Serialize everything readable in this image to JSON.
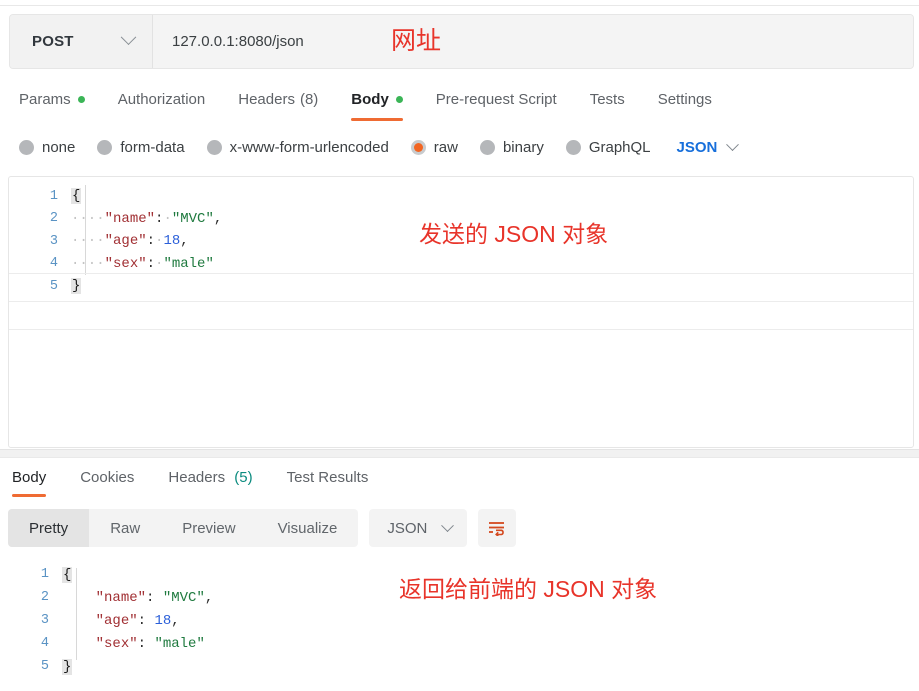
{
  "request": {
    "method": "POST",
    "url": "127.0.0.1:8080/json",
    "tabs": [
      {
        "label": "Params",
        "dot": true,
        "active": false
      },
      {
        "label": "Authorization",
        "dot": false,
        "active": false
      },
      {
        "label": "Headers",
        "count": "(8)",
        "dot": false,
        "active": false
      },
      {
        "label": "Body",
        "dot": true,
        "active": true
      },
      {
        "label": "Pre-request Script",
        "dot": false,
        "active": false
      },
      {
        "label": "Tests",
        "dot": false,
        "active": false
      },
      {
        "label": "Settings",
        "dot": false,
        "active": false
      }
    ],
    "body_types": [
      {
        "label": "none",
        "selected": false
      },
      {
        "label": "form-data",
        "selected": false
      },
      {
        "label": "x-www-form-urlencoded",
        "selected": false
      },
      {
        "label": "raw",
        "selected": true
      },
      {
        "label": "binary",
        "selected": false
      },
      {
        "label": "GraphQL",
        "selected": false
      }
    ],
    "format": "JSON",
    "editor": {
      "lines": [
        "1",
        "2",
        "3",
        "4",
        "5"
      ],
      "l1_open": "{",
      "l2_indent": "····",
      "l2_key": "\"name\"",
      "l2_colon": ":",
      "l2_sp": "·",
      "l2_val": "\"MVC\"",
      "l2_comma": ",",
      "l3_indent": "····",
      "l3_key": "\"age\"",
      "l3_colon": ":",
      "l3_sp": "·",
      "l3_val": "18",
      "l3_comma": ",",
      "l4_indent": "····",
      "l4_key": "\"sex\"",
      "l4_colon": ":",
      "l4_sp": "·",
      "l4_val": "\"male\"",
      "l5_close": "}"
    }
  },
  "response": {
    "tabs": [
      {
        "label": "Body",
        "active": true
      },
      {
        "label": "Cookies",
        "active": false
      },
      {
        "label": "Headers",
        "count": "(5)",
        "active": false
      },
      {
        "label": "Test Results",
        "active": false
      }
    ],
    "view_modes": [
      {
        "label": "Pretty",
        "active": true
      },
      {
        "label": "Raw",
        "active": false
      },
      {
        "label": "Preview",
        "active": false
      },
      {
        "label": "Visualize",
        "active": false
      }
    ],
    "format": "JSON",
    "wrap_icon": "word-wrap-icon",
    "editor": {
      "lines": [
        "1",
        "2",
        "3",
        "4",
        "5"
      ],
      "l1_open": "{",
      "l2_indent": "    ",
      "l2_key": "\"name\"",
      "l2_colon": ": ",
      "l2_val": "\"MVC\"",
      "l2_comma": ",",
      "l3_indent": "    ",
      "l3_key": "\"age\"",
      "l3_colon": ": ",
      "l3_val": "18",
      "l3_comma": ",",
      "l4_indent": "    ",
      "l4_key": "\"sex\"",
      "l4_colon": ": ",
      "l4_val": "\"male\"",
      "l5_close": "}"
    }
  },
  "annotations": {
    "url": "网址",
    "request_body": "发送的 JSON 对象",
    "response_body": "返回给前端的 JSON 对象"
  },
  "colors": {
    "accent_orange": "#ef6b33",
    "annotation_red": "#e8342a",
    "dot_green": "#3bb557",
    "format_blue": "#176fdb",
    "json_key": "#a12f33",
    "json_string": "#1f7a3f",
    "json_number": "#2b5fd9",
    "teal_count": "#0b8b7f"
  }
}
